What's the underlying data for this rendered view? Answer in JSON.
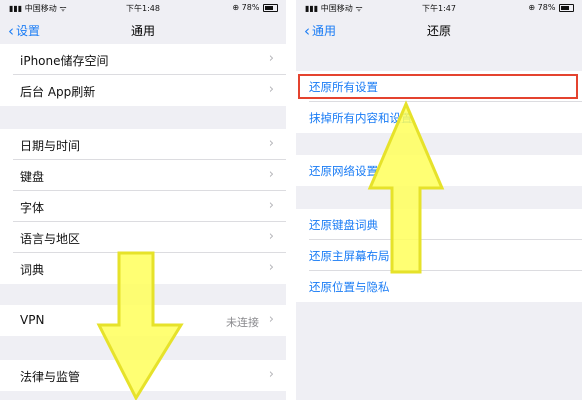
{
  "left": {
    "status": {
      "carrier": "中国移动",
      "time": "下午1:48",
      "battery": "78%"
    },
    "nav": {
      "back": "设置",
      "title": "通用"
    },
    "groups": [
      [
        "iPhone储存空间",
        "后台 App刷新"
      ],
      [
        "日期与时间",
        "键盘",
        "字体",
        "语言与地区",
        "词典"
      ],
      [
        {
          "label": "VPN",
          "detail": "未连接"
        }
      ],
      [
        "法律与监管"
      ]
    ]
  },
  "right": {
    "status": {
      "carrier": "中国移动",
      "time": "下午1:47",
      "battery": "78%"
    },
    "nav": {
      "back": "通用",
      "title": "还原"
    },
    "groups": [
      [
        "还原所有设置",
        "抹掉所有内容和设置"
      ],
      [
        "还原网络设置"
      ],
      [
        "还原键盘词典",
        "还原主屏幕布局",
        "还原位置与隐私"
      ]
    ]
  },
  "colors": {
    "accent": "#1a7cf5",
    "highlight": "#e4432f",
    "arrow_fill": "#ffff5a",
    "arrow_stroke": "#e6e22a"
  },
  "icons": {
    "signal": "signal-bars-icon",
    "wifi": "wifi-icon",
    "battery": "battery-icon",
    "back": "chevron-left-icon",
    "disclosure": "chevron-right-icon",
    "annotation": "yellow-arrow-icon"
  }
}
